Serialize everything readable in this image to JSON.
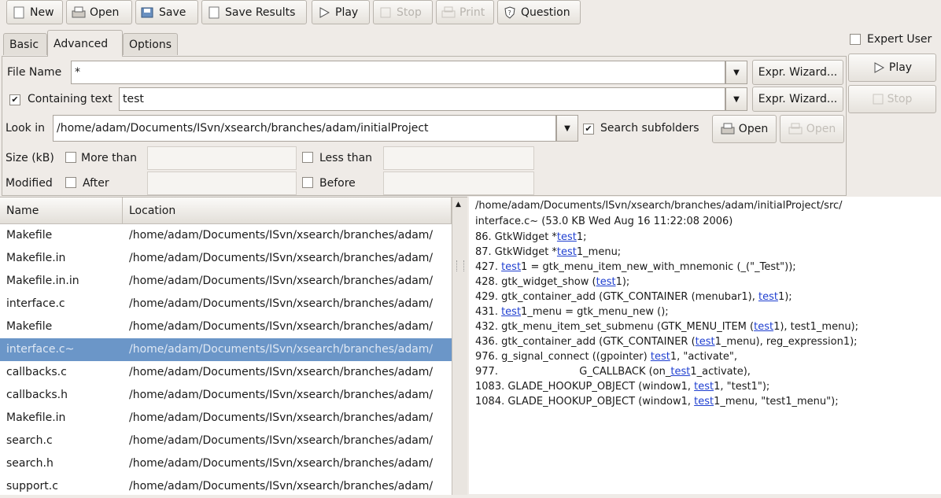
{
  "toolbar": {
    "new": "New",
    "open": "Open",
    "save": "Save",
    "save_results": "Save Results",
    "play": "Play",
    "stop": "Stop",
    "print": "Print",
    "question": "Question"
  },
  "tabs": [
    "Basic",
    "Advanced",
    "Options"
  ],
  "right_panel": {
    "expert_user": "Expert User",
    "play": "Play",
    "stop": "Stop"
  },
  "form": {
    "file_name_label": "File Name",
    "file_name_value": "*",
    "containing_text_label": "Containing text",
    "containing_text_value": "test",
    "expr_wizard": "Expr. Wizard...",
    "look_in_label": "Look in",
    "look_in_value": "/home/adam/Documents/ISvn/xsearch/branches/adam/initialProject",
    "search_subfolders": "Search subfolders",
    "open": "Open",
    "open_disabled": "Open",
    "size_label": "Size (kB)",
    "more_than": "More than",
    "less_than": "Less than",
    "modified_label": "Modified",
    "after": "After",
    "before": "Before"
  },
  "results": {
    "columns": [
      "Name",
      "Location"
    ],
    "rows": [
      {
        "name": "Makefile",
        "location": "/home/adam/Documents/ISvn/xsearch/branches/adam/"
      },
      {
        "name": "Makefile.in",
        "location": "/home/adam/Documents/ISvn/xsearch/branches/adam/"
      },
      {
        "name": "Makefile.in.in",
        "location": "/home/adam/Documents/ISvn/xsearch/branches/adam/"
      },
      {
        "name": "interface.c",
        "location": "/home/adam/Documents/ISvn/xsearch/branches/adam/"
      },
      {
        "name": "Makefile",
        "location": "/home/adam/Documents/ISvn/xsearch/branches/adam/"
      },
      {
        "name": "interface.c~",
        "location": "/home/adam/Documents/ISvn/xsearch/branches/adam/"
      },
      {
        "name": "callbacks.c",
        "location": "/home/adam/Documents/ISvn/xsearch/branches/adam/"
      },
      {
        "name": "callbacks.h",
        "location": "/home/adam/Documents/ISvn/xsearch/branches/adam/"
      },
      {
        "name": "Makefile.in",
        "location": "/home/adam/Documents/ISvn/xsearch/branches/adam/"
      },
      {
        "name": "search.c",
        "location": "/home/adam/Documents/ISvn/xsearch/branches/adam/"
      },
      {
        "name": "search.h",
        "location": "/home/adam/Documents/ISvn/xsearch/branches/adam/"
      },
      {
        "name": "support.c",
        "location": "/home/adam/Documents/ISvn/xsearch/branches/adam/"
      }
    ]
  },
  "preview": {
    "path": "/home/adam/Documents/ISvn/xsearch/branches/adam/initialProject/src/",
    "file_info": "interface.c~ (53.0 KB Wed Aug 16 11:22:08 2006)",
    "lines": [
      [
        "86.   GtkWidget *",
        "test",
        "1;"
      ],
      [
        "87.   GtkWidget *",
        "test",
        "1_menu;"
      ],
      [
        "427.   ",
        "test",
        "1 = gtk_menu_item_new_with_mnemonic (_(\"_Test\"));"
      ],
      [
        "428.   gtk_widget_show (",
        "test",
        "1);"
      ],
      [
        "429.   gtk_container_add (GTK_CONTAINER (menubar1), ",
        "test",
        "1);"
      ],
      [
        "431.   ",
        "test",
        "1_menu = gtk_menu_new ();"
      ],
      [
        "432.   gtk_menu_item_set_submenu (GTK_MENU_ITEM (",
        "test",
        "1), test1_menu);"
      ],
      [
        "436.   gtk_container_add (GTK_CONTAINER (",
        "test",
        "1_menu), reg_expression1);"
      ],
      [
        "976.   g_signal_connect ((gpointer) ",
        "test",
        "1, \"activate\","
      ],
      [
        "977.                         G_CALLBACK (on_",
        "test",
        "1_activate),"
      ],
      [
        "1083.   GLADE_HOOKUP_OBJECT (window1, ",
        "test",
        "1, \"test1\");"
      ],
      [
        "1084.   GLADE_HOOKUP_OBJECT (window1, ",
        "test",
        "1_menu, \"test1_menu\");"
      ]
    ]
  }
}
